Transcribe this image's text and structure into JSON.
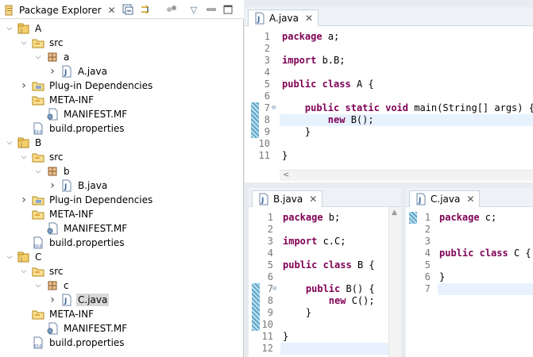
{
  "package_explorer": {
    "title": "Package Explorer",
    "tree": [
      {
        "label": "A",
        "icon": "project-icon"
      },
      {
        "label": "src",
        "icon": "folder-icon"
      },
      {
        "label": "a",
        "icon": "package-icon"
      },
      {
        "label": "A.java",
        "icon": "java-file-icon"
      },
      {
        "label": "Plug-in Dependencies",
        "icon": "library-icon"
      },
      {
        "label": "META-INF",
        "icon": "folder-icon"
      },
      {
        "label": "MANIFEST.MF",
        "icon": "manifest-icon"
      },
      {
        "label": "build.properties",
        "icon": "properties-icon"
      },
      {
        "label": "B",
        "icon": "project-icon"
      },
      {
        "label": "src",
        "icon": "folder-icon"
      },
      {
        "label": "b",
        "icon": "package-icon"
      },
      {
        "label": "B.java",
        "icon": "java-file-icon"
      },
      {
        "label": "Plug-in Dependencies",
        "icon": "library-icon"
      },
      {
        "label": "META-INF",
        "icon": "folder-icon"
      },
      {
        "label": "MANIFEST.MF",
        "icon": "manifest-icon"
      },
      {
        "label": "build.properties",
        "icon": "properties-icon"
      },
      {
        "label": "C",
        "icon": "project-icon"
      },
      {
        "label": "src",
        "icon": "folder-icon"
      },
      {
        "label": "c",
        "icon": "package-icon"
      },
      {
        "label": "C.java",
        "icon": "java-file-icon"
      },
      {
        "label": "META-INF",
        "icon": "folder-icon"
      },
      {
        "label": "MANIFEST.MF",
        "icon": "manifest-icon"
      },
      {
        "label": "build.properties",
        "icon": "properties-icon"
      }
    ]
  },
  "editor_a": {
    "tab": "A.java",
    "lines": [
      "package a;",
      "",
      "import b.B;",
      "",
      "public class A {",
      "",
      "    public static void main(String[] args) {",
      "        new B();",
      "    }",
      "",
      "}"
    ],
    "numbers": [
      "1",
      "2",
      "3",
      "4",
      "5",
      "6",
      "7",
      "8",
      "9",
      "10",
      "11"
    ]
  },
  "editor_b": {
    "tab": "B.java",
    "lines": [
      "package b;",
      "",
      "import c.C;",
      "",
      "public class B {",
      "",
      "    public B() {",
      "        new C();",
      "    }",
      "",
      "}",
      ""
    ],
    "numbers": [
      "1",
      "2",
      "3",
      "4",
      "5",
      "6",
      "7",
      "8",
      "9",
      "10",
      "11",
      "12"
    ]
  },
  "editor_c": {
    "tab": "C.java",
    "lines": [
      "package c;",
      "",
      "",
      "public class C {",
      "",
      "}",
      ""
    ],
    "numbers": [
      "1",
      "2",
      "3",
      "4",
      "5",
      "6",
      "7"
    ]
  },
  "colors": {
    "keyword": "#7f0055",
    "line_highlight": "#e8f2fe"
  }
}
